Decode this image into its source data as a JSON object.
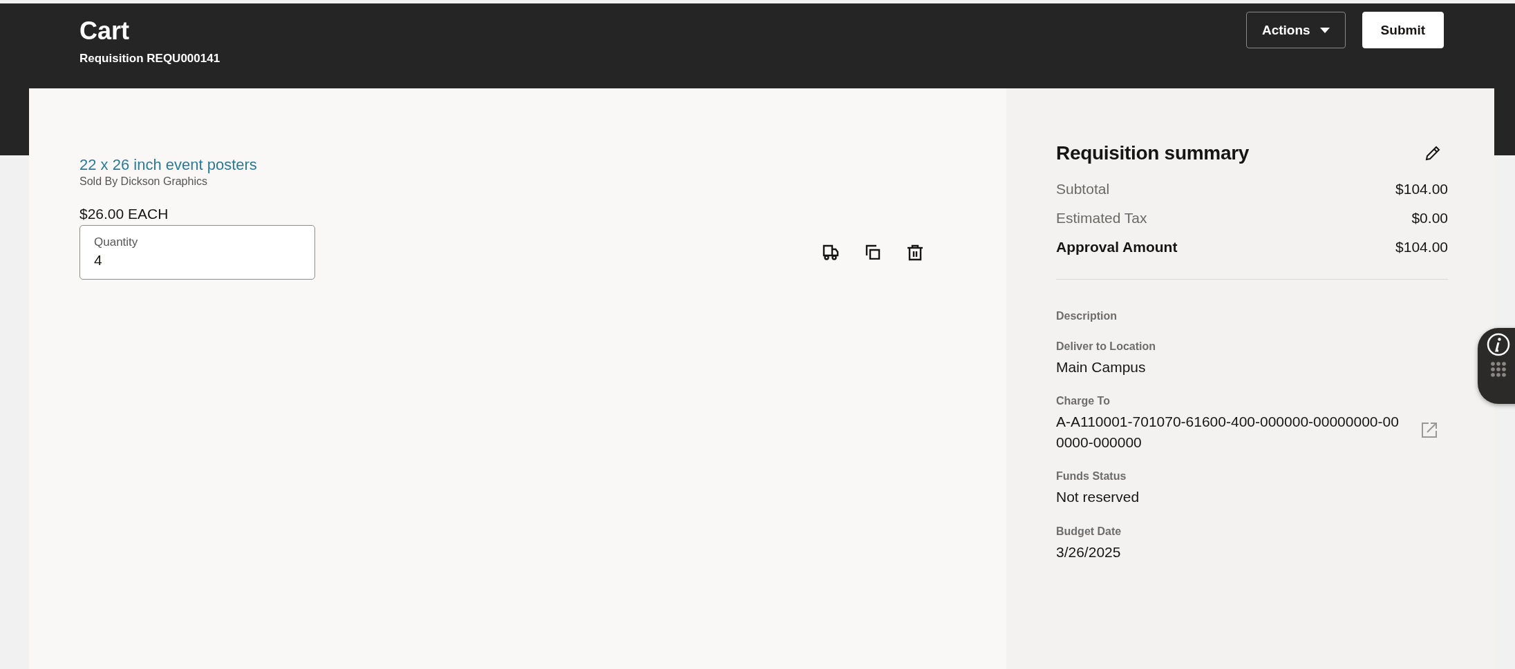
{
  "header": {
    "title": "Cart",
    "subtitle": "Requisition REQU000141",
    "actions_button": {
      "label": "Actions"
    },
    "submit_button": {
      "label": "Submit"
    }
  },
  "cart_items": [
    {
      "name": "22 x 26 inch event posters",
      "seller": "Sold By Dickson Graphics",
      "price": "$26.00 EACH",
      "quantity": {
        "label": "Quantity",
        "value": "4"
      }
    }
  ],
  "summary": {
    "title": "Requisition summary",
    "totals": [
      {
        "label": "Subtotal",
        "value": "$104.00",
        "bold": false
      },
      {
        "label": "Estimated Tax",
        "value": "$0.00",
        "bold": false
      },
      {
        "label": "Approval Amount",
        "value": "$104.00",
        "bold": true
      }
    ],
    "fields": [
      {
        "label": "Description"
      },
      {
        "label": "Deliver to Location",
        "value": "Main Campus",
        "kind": "text"
      },
      {
        "label": "Charge To",
        "value": "A-A110001-701070-61600-400-000000-00000000-000000-000000",
        "kind": "link"
      },
      {
        "label": "Funds Status",
        "value": "Not reserved",
        "kind": "text"
      },
      {
        "label": "Budget Date",
        "value": "3/26/2025",
        "kind": "text"
      }
    ]
  }
}
